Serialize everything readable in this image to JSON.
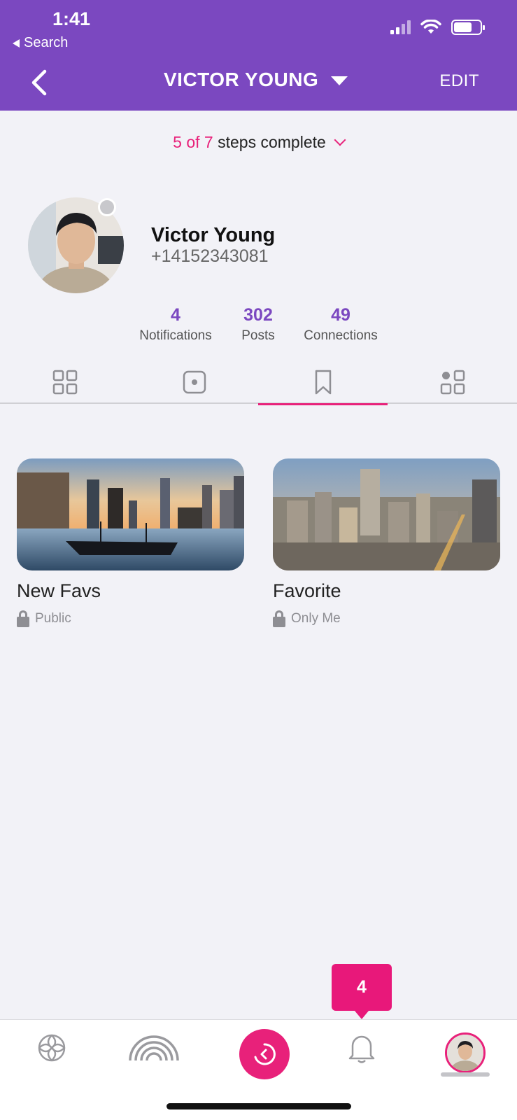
{
  "status_bar": {
    "time": "1:41",
    "back_app": "Search",
    "icons": [
      "signal-icon",
      "wifi-icon",
      "battery-icon"
    ]
  },
  "header": {
    "title": "VICTOR YOUNG",
    "edit_label": "EDIT",
    "background": "#7b48c0"
  },
  "steps": {
    "progress": "5 of 7",
    "suffix": " steps complete",
    "accent": "#e8217a"
  },
  "profile": {
    "name": "Victor Young",
    "phone": "+14152343081"
  },
  "stats": [
    {
      "value": "4",
      "label": "Notifications"
    },
    {
      "value": "302",
      "label": "Posts"
    },
    {
      "value": "49",
      "label": "Connections"
    }
  ],
  "tabs": [
    {
      "icon": "grid-icon",
      "active": false
    },
    {
      "icon": "square-dot-icon",
      "active": false
    },
    {
      "icon": "bookmark-icon",
      "active": true
    },
    {
      "icon": "apps-icon",
      "active": false
    }
  ],
  "collections": [
    {
      "name": "New Favs",
      "privacy": "Public"
    },
    {
      "name": "Favorite",
      "privacy": "Only Me"
    }
  ],
  "notification_badge": "4",
  "bottom_nav": [
    "flower-icon",
    "rainbow-icon",
    "history-icon",
    "bell-icon",
    "profile-avatar"
  ]
}
